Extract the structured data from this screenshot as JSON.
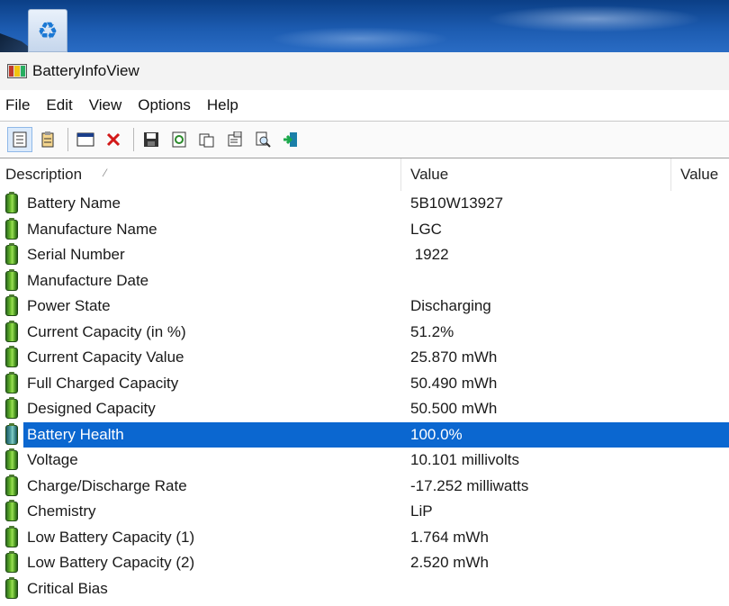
{
  "window": {
    "title": "BatteryInfoView"
  },
  "menu": [
    "File",
    "Edit",
    "View",
    "Options",
    "Help"
  ],
  "columns": {
    "description": "Description",
    "value": "Value",
    "value2": "Value"
  },
  "rows": [
    {
      "label": "Battery Name",
      "value": "5B10W13927"
    },
    {
      "label": "Manufacture Name",
      "value": "LGC"
    },
    {
      "label": "Serial Number",
      "value": " 1922"
    },
    {
      "label": "Manufacture Date",
      "value": ""
    },
    {
      "label": "Power State",
      "value": "Discharging"
    },
    {
      "label": "Current Capacity (in %)",
      "value": "51.2%"
    },
    {
      "label": "Current Capacity Value",
      "value": "25.870 mWh"
    },
    {
      "label": "Full Charged Capacity",
      "value": "50.490 mWh"
    },
    {
      "label": "Designed Capacity",
      "value": "50.500 mWh"
    },
    {
      "label": "Battery Health",
      "value": "100.0%",
      "selected": true
    },
    {
      "label": "Voltage",
      "value": "10.101 millivolts"
    },
    {
      "label": "Charge/Discharge Rate",
      "value": "-17.252 milliwatts"
    },
    {
      "label": "Chemistry",
      "value": "LiP"
    },
    {
      "label": "Low Battery Capacity (1)",
      "value": "1.764 mWh"
    },
    {
      "label": "Low Battery Capacity (2)",
      "value": "2.520 mWh"
    },
    {
      "label": "Critical Bias",
      "value": ""
    }
  ],
  "colors": {
    "selection": "#0b67d0",
    "battery_green": "#6cbf2d"
  }
}
